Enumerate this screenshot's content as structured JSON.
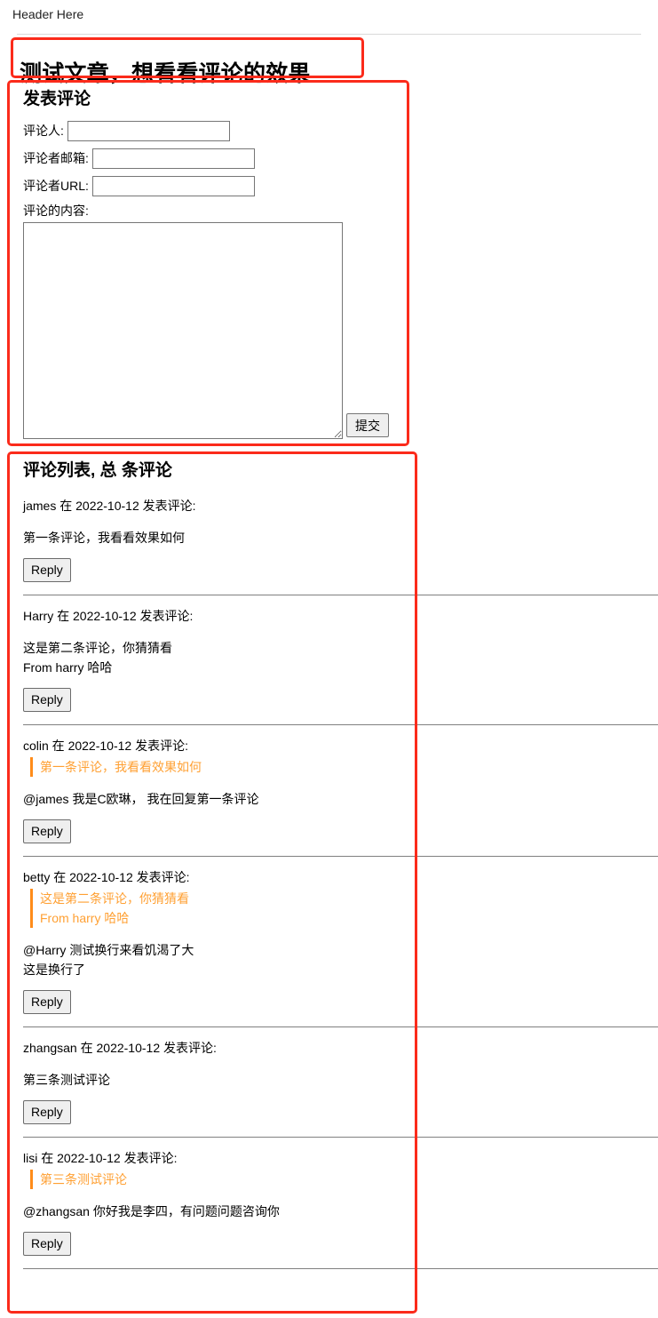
{
  "header": {
    "text": "Header Here"
  },
  "article": {
    "title": "测试文章，想看看评论的效果"
  },
  "form": {
    "heading": "发表评论",
    "fields": [
      {
        "label": "评论人:",
        "value": "",
        "placeholder": "",
        "name": "commenter-name"
      },
      {
        "label": "评论者邮箱:",
        "value": "",
        "placeholder": "",
        "name": "commenter-email"
      },
      {
        "label": "评论者URL:",
        "value": "",
        "placeholder": "",
        "name": "commenter-url"
      }
    ],
    "textarea_label": "评论的内容:",
    "textarea_value": "",
    "textarea_placeholder": "",
    "submit_label": "提交"
  },
  "comments": {
    "heading": "评论列表, 总 条评论",
    "reply_label": "Reply",
    "items": [
      {
        "meta": "james 在 2022-10-12 发表评论:",
        "quote": "",
        "body": "第一条评论，我看看效果如何"
      },
      {
        "meta": "Harry 在 2022-10-12 发表评论:",
        "quote": "",
        "body": "这是第二条评论，你猜猜看\nFrom harry 哈哈"
      },
      {
        "meta": "colin 在 2022-10-12 发表评论:",
        "quote": "第一条评论，我看看效果如何",
        "body": "@james 我是C欧琳， 我在回复第一条评论"
      },
      {
        "meta": "betty 在 2022-10-12 发表评论:",
        "quote": "这是第二条评论，你猜猜看\nFrom harry 哈哈",
        "body": "@Harry 测试换行来看饥渴了大\n这是换行了"
      },
      {
        "meta": "zhangsan 在 2022-10-12 发表评论:",
        "quote": "",
        "body": "第三条测试评论"
      },
      {
        "meta": "lisi 在 2022-10-12 发表评论:",
        "quote": "第三条测试评论",
        "body": "@zhangsan 你好我是李四，有问题问题咨询你"
      }
    ]
  },
  "colors": {
    "annotation": "#fb2b1b",
    "quote": "#ffa033",
    "quote_border": "#ff8c1a",
    "separator": "#808080"
  }
}
